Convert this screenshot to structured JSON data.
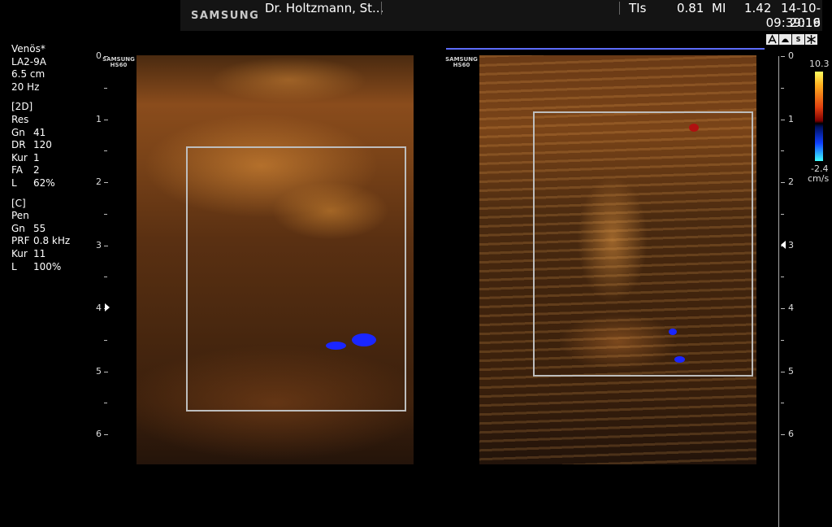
{
  "header": {
    "brand": "SAMSUNG",
    "physician": "Dr. Holtzmann, St...",
    "tis_label": "TIs",
    "tis_value": "0.81",
    "mi_label": "MI",
    "mi_value": "1.42",
    "date": "14-10-2019",
    "time": "09:39:16"
  },
  "status_icons": [
    "a-icon",
    "probe-icon",
    "s-icon",
    "snowflake-icon"
  ],
  "status_icon_text": {
    "s": "S"
  },
  "params": {
    "preset": "Venös*",
    "probe": "LA2-9A",
    "depth": "6.5 cm",
    "frame_rate": "20 Hz",
    "mode_2d": {
      "title": "[2D]",
      "res": "Res",
      "rows": [
        {
          "k": "Gn",
          "v": "41"
        },
        {
          "k": "DR",
          "v": "120"
        },
        {
          "k": "Kur",
          "v": "1"
        },
        {
          "k": "FA",
          "v": "2"
        },
        {
          "k": "L",
          "v": "62%"
        }
      ]
    },
    "mode_c": {
      "title": "[C]",
      "pen": "Pen",
      "rows": [
        {
          "k": "Gn",
          "v": "55"
        },
        {
          "k": "PRF",
          "v": "0.8 kHz"
        },
        {
          "k": "Kur",
          "v": "11"
        },
        {
          "k": "L",
          "v": "100%"
        }
      ]
    }
  },
  "image_logo": {
    "line1": "SAMSUNG",
    "line2": "HS60"
  },
  "depth_scale_labels": [
    "0",
    "1",
    "2",
    "3",
    "4",
    "5",
    "6"
  ],
  "color_scale": {
    "max": "10.3",
    "min": "-2.4",
    "unit": "cm/s"
  },
  "colors": {
    "flow_blue": "#1a26ff",
    "flow_red": "#b01010",
    "roi": "#bdbdbd",
    "marker_line": "#5c6cff"
  }
}
